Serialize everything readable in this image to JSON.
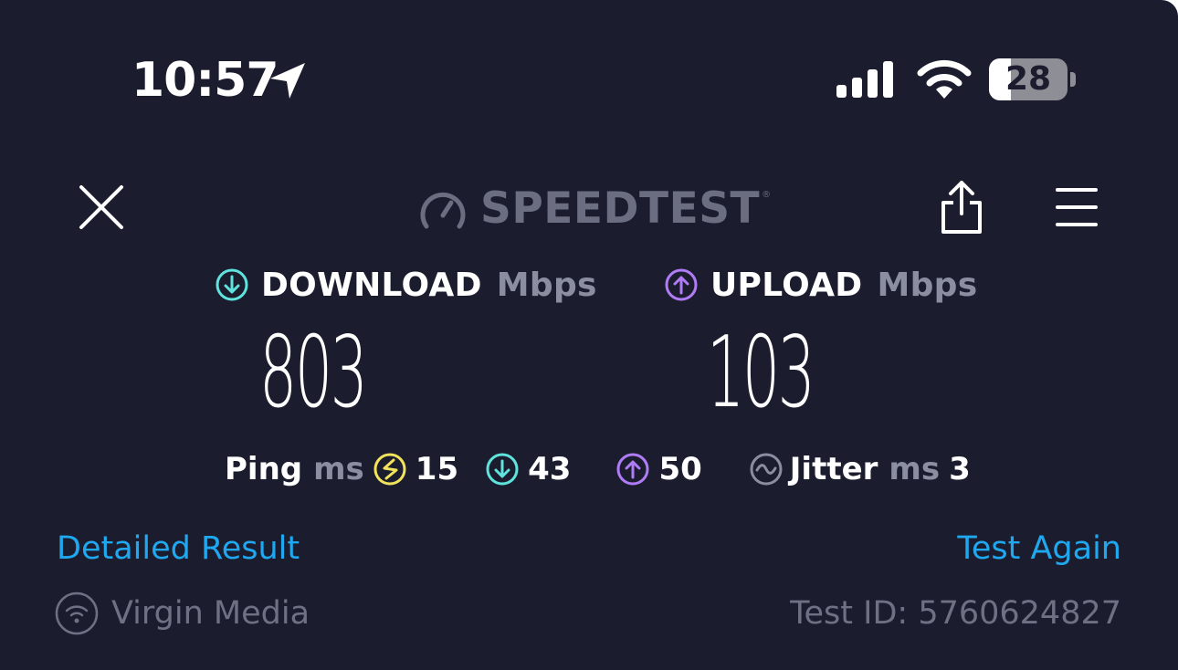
{
  "status_bar": {
    "time": "10:57",
    "location_icon": "location-arrow-icon",
    "signal_icon": "cellular-signal-icon",
    "wifi_icon": "wifi-icon",
    "battery_level": "28",
    "battery_fraction": 0.28
  },
  "header": {
    "close_icon": "close-icon",
    "brand": "SPEEDTEST",
    "brand_mark": "®",
    "brand_icon": "speedometer-icon",
    "share_icon": "share-icon",
    "menu_icon": "hamburger-menu-icon"
  },
  "download": {
    "label": "DOWNLOAD",
    "unit": "Mbps",
    "value": "803",
    "icon": "arrow-down-circle-icon",
    "color": "#5fe3dc"
  },
  "upload": {
    "label": "UPLOAD",
    "unit": "Mbps",
    "value": "103",
    "icon": "arrow-up-circle-icon",
    "color": "#b07cf5"
  },
  "ping": {
    "label": "Ping",
    "unit": "ms",
    "idle_value": "15",
    "idle_icon": "ping-idle-icon",
    "idle_color": "#f2e35c",
    "download_value": "43",
    "upload_value": "50"
  },
  "jitter": {
    "label": "Jitter",
    "unit": "ms",
    "value": "3",
    "icon": "jitter-wave-icon"
  },
  "links": {
    "detailed": "Detailed Result",
    "again": "Test Again",
    "color": "#1fa8f0"
  },
  "footer": {
    "provider": "Virgin Media",
    "provider_icon": "wifi-circle-icon",
    "test_id": "Test ID: 5760624827"
  },
  "colors": {
    "background": "#1b1d2f",
    "muted": "#8b8ea0"
  }
}
